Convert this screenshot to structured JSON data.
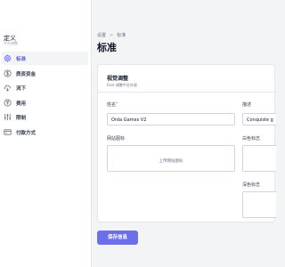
{
  "sidebar": {
    "brand_title": "定义",
    "brand_sub": "平台调整",
    "items": [
      {
        "label": "标准",
        "icon": "gear-icon",
        "active": true
      },
      {
        "label": "质资资金",
        "icon": "dollar-icon",
        "active": false
      },
      {
        "label": "流下",
        "icon": "cloud-download-icon",
        "active": false
      },
      {
        "label": "费用",
        "icon": "coin-icon",
        "active": false
      },
      {
        "label": "限制",
        "icon": "sliders-icon",
        "active": false
      },
      {
        "label": "付款方式",
        "icon": "payment-card-icon",
        "active": false
      }
    ]
  },
  "breadcrumb": {
    "root": "设置",
    "separator": ">",
    "current": "标准"
  },
  "page_title": "标准",
  "card": {
    "title": "视觉调整",
    "subtitle": "Fore 调整平台外观",
    "name_label": "姓名",
    "required_mark": "*",
    "name_value": "Orda Games V2",
    "desc_label": "描述",
    "desc_value": "Conquiste g",
    "favicon_label": "网站图标",
    "favicon_upload_text": "上传网站图标",
    "white_logo_label": "白色标志",
    "dark_logo_label": "深色标志"
  },
  "save_button": "保存信息",
  "colors": {
    "accent": "#6d6fe8",
    "active_text": "#5b5bd6"
  }
}
